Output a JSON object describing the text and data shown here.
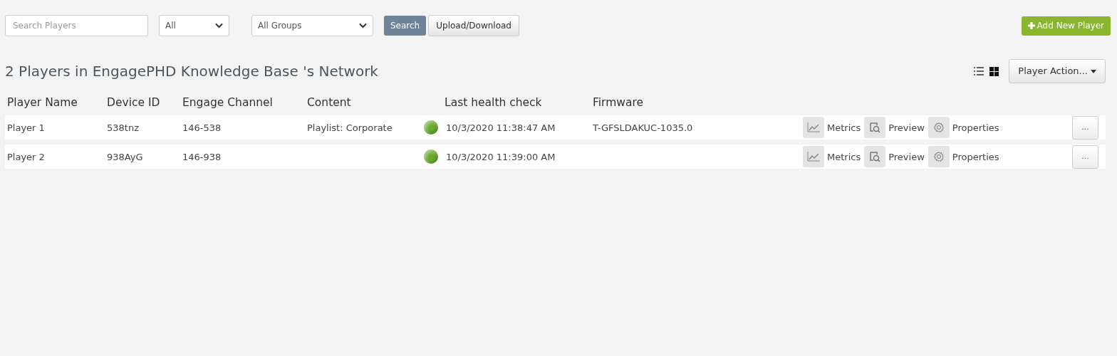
{
  "toolbar": {
    "search": {
      "placeholder": "Search Players"
    },
    "status_filter": {
      "value": "All"
    },
    "group_filter": {
      "value": "All Groups"
    },
    "search_button": "Search",
    "upload_button": "Upload/Download",
    "add_button": "Add New Player"
  },
  "heading": "2 Players in EngagePHD Knowledge Base 's Network",
  "view_modes": [
    {
      "kind": "list",
      "selected": false
    },
    {
      "kind": "grid",
      "selected": true
    }
  ],
  "actions_menu": "Player Action...",
  "table": {
    "columns": [
      "Player Name",
      "Device ID",
      "Engage Channel",
      "Content",
      "Last health check",
      "Firmware"
    ],
    "rows": [
      {
        "name": "Player 1",
        "device_id": "538tnz",
        "channel": "146-538",
        "content": "Playlist: Corporate",
        "color": "#6aaa2e",
        "last_check": "10/3/2020 11:38:47 AM",
        "firmware": "T-GFSLDAKUC-1035.0",
        "actions": [
          "Metrics",
          "Preview",
          "Properties"
        ],
        "more": "..."
      },
      {
        "name": "Player 2",
        "device_id": "938AyG",
        "channel": "146-938",
        "content": "",
        "color": "#6aaa2e",
        "last_check": "10/3/2020 11:39:00 AM",
        "firmware": "",
        "actions": [
          "Metrics",
          "Preview",
          "Properties"
        ],
        "more": "..."
      }
    ]
  }
}
